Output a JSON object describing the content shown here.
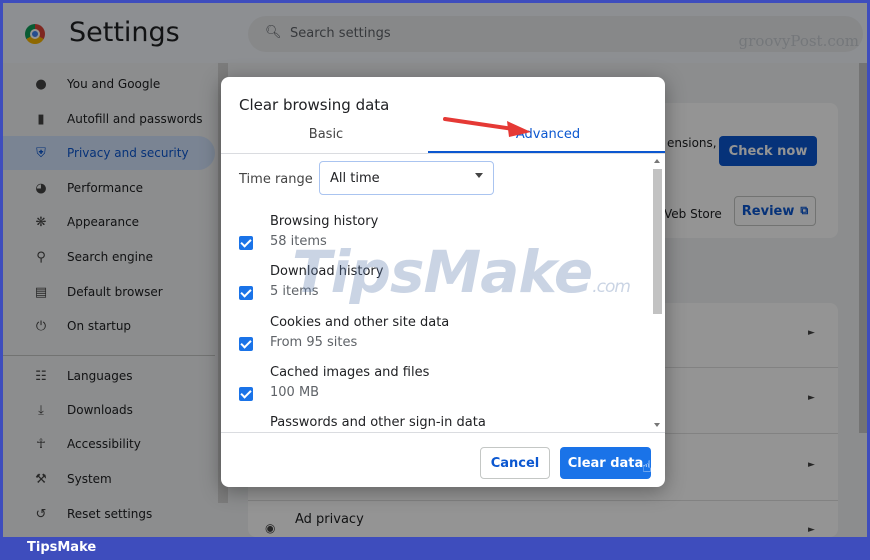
{
  "header": {
    "title": "Settings",
    "search_placeholder": "Search settings",
    "watermark": "groovyPost.com"
  },
  "sidebar": {
    "items": [
      {
        "label": "You and Google",
        "icon": "person-icon"
      },
      {
        "label": "Autofill and passwords",
        "icon": "clipboard-icon"
      },
      {
        "label": "Privacy and security",
        "icon": "shield-icon",
        "active": true
      },
      {
        "label": "Performance",
        "icon": "speedometer-icon"
      },
      {
        "label": "Appearance",
        "icon": "palette-icon"
      },
      {
        "label": "Search engine",
        "icon": "search-icon"
      },
      {
        "label": "Default browser",
        "icon": "browser-icon"
      },
      {
        "label": "On startup",
        "icon": "power-icon"
      },
      {
        "label": "Languages",
        "icon": "globe-icon"
      },
      {
        "label": "Downloads",
        "icon": "download-icon"
      },
      {
        "label": "Accessibility",
        "icon": "accessibility-icon"
      },
      {
        "label": "System",
        "icon": "wrench-icon"
      },
      {
        "label": "Reset settings",
        "icon": "reset-icon"
      }
    ]
  },
  "main": {
    "extensions_text": "ensions,",
    "check_now_label": "Check now",
    "web_store_text": "Veb Store",
    "review_label": "Review",
    "ad_privacy_label": "Ad privacy"
  },
  "dialog": {
    "title": "Clear browsing data",
    "tabs": {
      "basic": "Basic",
      "advanced": "Advanced"
    },
    "time_range_label": "Time range",
    "time_range_value": "All time",
    "items": [
      {
        "title": "Browsing history",
        "subtitle": "58 items",
        "checked": true
      },
      {
        "title": "Download history",
        "subtitle": "5 items",
        "checked": true
      },
      {
        "title": "Cookies and other site data",
        "subtitle": "From 95 sites",
        "checked": true
      },
      {
        "title": "Cached images and files",
        "subtitle": "100 MB",
        "checked": true
      },
      {
        "title": "Passwords and other sign-in data",
        "subtitle": "",
        "checked": true
      }
    ],
    "cancel_label": "Cancel",
    "clear_label": "Clear data"
  },
  "watermark": {
    "main": "TipsMake",
    "suffix": ".com"
  },
  "banner": {
    "text": "TipsMake"
  },
  "colors": {
    "accent": "#1a73e8",
    "banner": "#3e4dbd"
  }
}
